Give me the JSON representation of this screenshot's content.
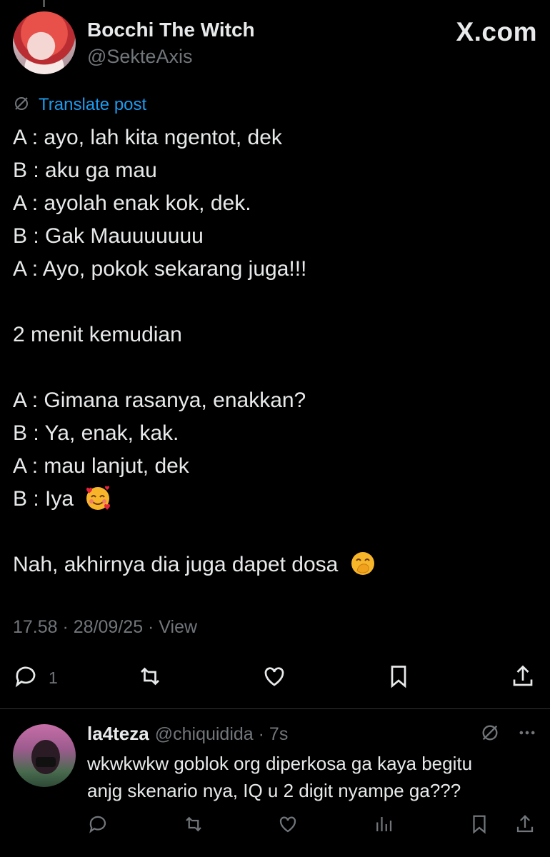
{
  "header": {
    "display_name": "Bocchi The Witch",
    "handle": "@SekteAxis",
    "brand": "X.com"
  },
  "translate": {
    "label": "Translate post",
    "icon": "translate-icon"
  },
  "post": {
    "lines": [
      "A : ayo, lah kita ngentot, dek",
      "B : aku ga mau",
      "A : ayolah enak kok, dek.",
      "B : Gak Mauuuuuuu",
      "A : Ayo, pokok sekarang juga!!!",
      "",
      "2 menit kemudian",
      "",
      "A : Gimana rasanya, enakkan?",
      "B : Ya, enak, kak.",
      "A : mau lanjut, dek",
      "B : Iya",
      "",
      "Nah, akhirnya dia juga dapet dosa"
    ],
    "emojis": [
      "smiling-face-with-hearts",
      "face-with-hand-over-mouth"
    ],
    "meta": "17.58 · 28/09/25 · View"
  },
  "actions": {
    "reply_count": "1",
    "icons": [
      "reply-icon",
      "repost-icon",
      "like-icon",
      "bookmark-icon",
      "share-icon"
    ]
  },
  "reply": {
    "name": "la4teza",
    "handle_time": "@chiquidida · 7s",
    "text_lines": [
      "wkwkwkw goblok org diperkosa ga kaya begitu",
      "anjg skenario nya, IQ u 2 digit nyampe ga???"
    ],
    "icons": [
      "reply-icon",
      "repost-icon",
      "like-icon",
      "views-icon",
      "bookmark-icon",
      "share-icon"
    ]
  },
  "colors": {
    "background": "#000000",
    "text": "#e7e9ea",
    "muted": "#71767b",
    "link": "#1d9bf0",
    "divider": "#2f3336"
  }
}
